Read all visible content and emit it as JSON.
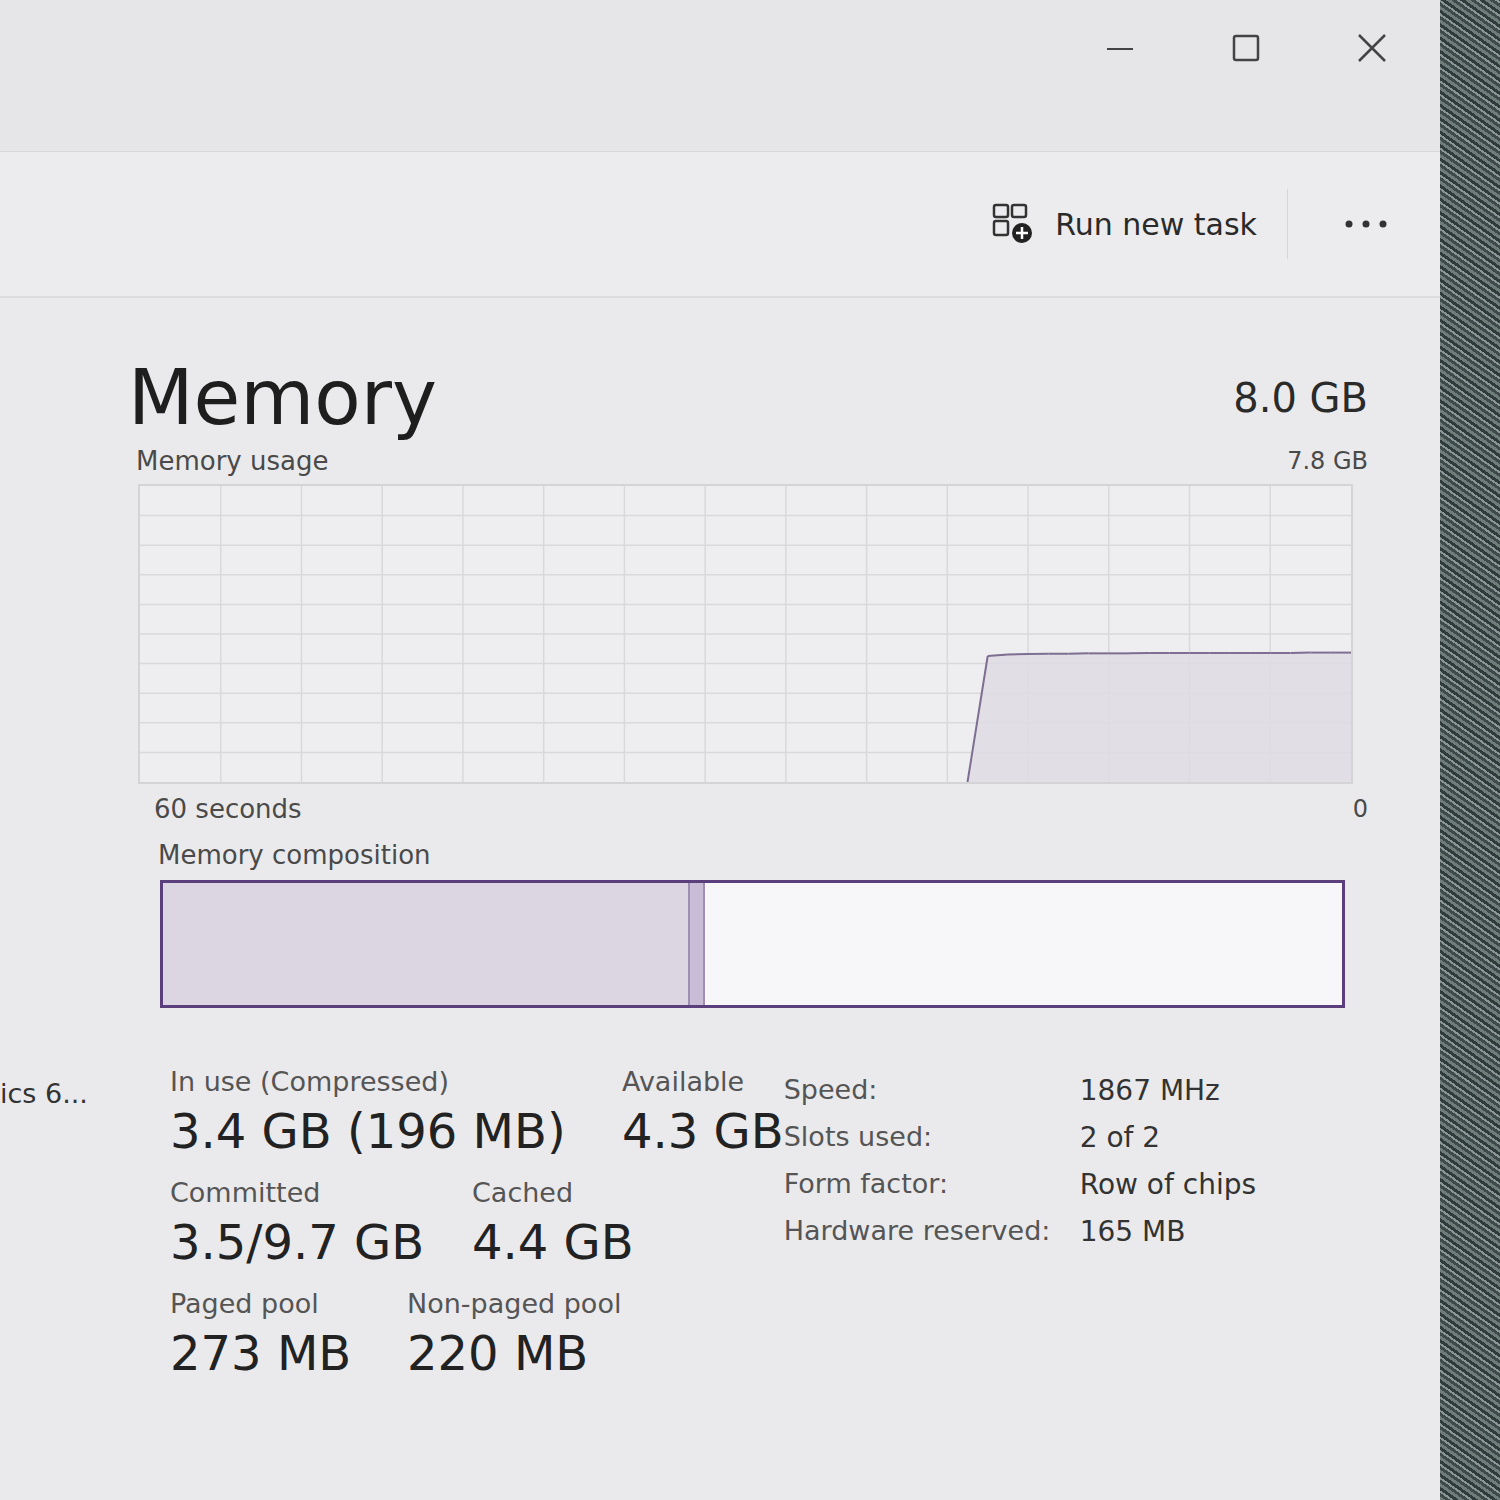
{
  "command_bar": {
    "run_task": "Run new task"
  },
  "sidebar": {
    "items": [
      {
        "label": "ics 6..."
      }
    ]
  },
  "memory": {
    "title": "Memory",
    "total": "8.0 GB"
  },
  "chart": {
    "title": "Memory usage",
    "max_label": "7.8 GB",
    "max": 7.8,
    "time_label": "60 seconds",
    "min_label": "0",
    "window_seconds": 60,
    "values": [
      0,
      3.32,
      3.36,
      3.37,
      3.38,
      3.38,
      3.39,
      3.39,
      3.39,
      3.4,
      3.4,
      3.4,
      3.4,
      3.4,
      3.4,
      3.4,
      3.4,
      3.41,
      3.41,
      3.41
    ]
  },
  "composition": {
    "title": "Memory composition",
    "segments": [
      {
        "kind": "in-use",
        "level": 0.447,
        "color": "#dcd5e2"
      },
      {
        "kind": "modified",
        "level": 0.013,
        "color": "#c9bcd6"
      },
      {
        "kind": "standby",
        "level": 0.54,
        "color": "#f7f7f9"
      }
    ]
  },
  "stats": [
    [
      {
        "label": "In use (Compressed)",
        "value": "3.4 GB (196 MB)"
      },
      {
        "label": "Available",
        "value": "4.3 GB"
      }
    ],
    [
      {
        "label": "Committed",
        "value": "3.5/9.7 GB"
      },
      {
        "label": "Cached",
        "value": "4.4 GB"
      }
    ],
    [
      {
        "label": "Paged pool",
        "value": "273 MB"
      },
      {
        "label": "Non-paged pool",
        "value": "220 MB"
      }
    ]
  ],
  "specs": [
    {
      "label": "Speed:",
      "value": "1867 MHz"
    },
    {
      "label": "Slots used:",
      "value": "2 of 2"
    },
    {
      "label": "Form factor:",
      "value": "Row of chips"
    },
    {
      "label": "Hardware reserved:",
      "value": "165 MB"
    }
  ]
}
